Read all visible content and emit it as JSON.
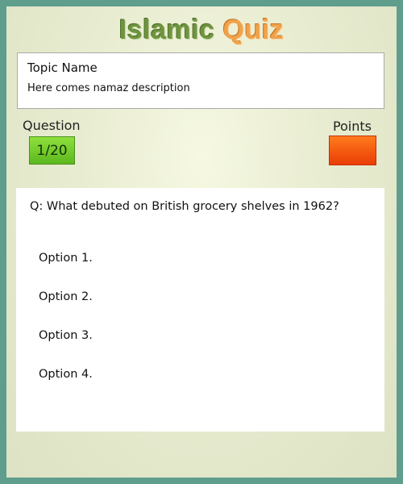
{
  "header": {
    "title_part1": "Islamic",
    "title_part2": "Quiz",
    "colors": {
      "title_green": "#6f9440",
      "title_orange": "#f0a24a"
    }
  },
  "topic": {
    "name": "Topic Name",
    "description": "Here comes namaz description"
  },
  "status": {
    "question_label": "Question",
    "question_counter": "1/20",
    "points_label": "Points",
    "points_value": "",
    "colors": {
      "question_badge": "#6dc62a",
      "points_badge": "#f45a12"
    }
  },
  "quiz": {
    "question": "Q: What debuted on British grocery shelves in 1962?",
    "options": [
      "Option 1.",
      "Option 2.",
      "Option 3.",
      "Option 4."
    ]
  },
  "theme": {
    "border_color": "#5f9e8c",
    "background_color": "#e8ecd0"
  }
}
